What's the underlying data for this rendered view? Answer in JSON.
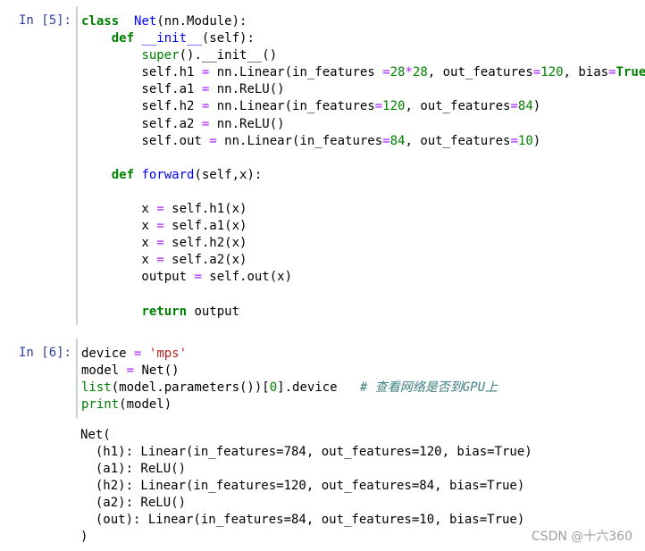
{
  "cells": [
    {
      "prompt": "In  [5]:",
      "lines": [
        [
          [
            "kw",
            "class"
          ],
          [
            "",
            "  "
          ],
          [
            "cls",
            "Net"
          ],
          [
            "",
            "(nn.Module):"
          ]
        ],
        [
          [
            "",
            "    "
          ],
          [
            "kw",
            "def"
          ],
          [
            "",
            ""
          ],
          [
            "fn",
            " __init__"
          ],
          [
            "",
            "(self):"
          ]
        ],
        [
          [
            "",
            "        "
          ],
          [
            "bi",
            "super"
          ],
          [
            "",
            "().__init__()"
          ]
        ],
        [
          [
            "",
            "        self.h1 "
          ],
          [
            "op",
            "="
          ],
          [
            "",
            ""
          ],
          [
            "",
            ""
          ],
          [
            "",
            " nn.Linear(in_features "
          ],
          [
            "op",
            "="
          ],
          [
            "num",
            "28"
          ],
          [
            "op",
            "*"
          ],
          [
            "num",
            "28"
          ],
          [
            "",
            ", out_features"
          ],
          [
            "op",
            "="
          ],
          [
            "num",
            "120"
          ],
          [
            "",
            ", bias"
          ],
          [
            "op",
            "="
          ],
          [
            "kw",
            "True"
          ],
          [
            "",
            ")"
          ]
        ],
        [
          [
            "",
            "        self.a1 "
          ],
          [
            "op",
            "="
          ],
          [
            "",
            " nn.ReLU()"
          ]
        ],
        [
          [
            "",
            "        self.h2 "
          ],
          [
            "op",
            "="
          ],
          [
            "",
            " nn.Linear(in_features"
          ],
          [
            "op",
            "="
          ],
          [
            "num",
            "120"
          ],
          [
            "",
            ", out_features"
          ],
          [
            "op",
            "="
          ],
          [
            "num",
            "84"
          ],
          [
            "",
            ")"
          ]
        ],
        [
          [
            "",
            "        self.a2 "
          ],
          [
            "op",
            "="
          ],
          [
            "",
            " nn.ReLU()"
          ]
        ],
        [
          [
            "",
            "        self.out "
          ],
          [
            "op",
            "="
          ],
          [
            "",
            " nn.Linear(in_features"
          ],
          [
            "op",
            "="
          ],
          [
            "num",
            "84"
          ],
          [
            "",
            ", out_features"
          ],
          [
            "op",
            "="
          ],
          [
            "num",
            "10"
          ],
          [
            "",
            ")"
          ]
        ],
        [
          [
            "",
            ""
          ]
        ],
        [
          [
            "",
            "    "
          ],
          [
            "kw",
            "def"
          ],
          [
            "fn",
            " forward"
          ],
          [
            "",
            "(self,x):"
          ]
        ],
        [
          [
            "",
            ""
          ]
        ],
        [
          [
            "",
            "        x "
          ],
          [
            "op",
            "="
          ],
          [
            "",
            " self.h1(x)"
          ]
        ],
        [
          [
            "",
            "        x "
          ],
          [
            "op",
            "="
          ],
          [
            "",
            " self.a1(x)"
          ]
        ],
        [
          [
            "",
            "        x "
          ],
          [
            "op",
            "="
          ],
          [
            "",
            " self.h2(x)"
          ]
        ],
        [
          [
            "",
            "        x "
          ],
          [
            "op",
            "="
          ],
          [
            "",
            " self.a2(x)"
          ]
        ],
        [
          [
            "",
            "        output "
          ],
          [
            "op",
            "="
          ],
          [
            "",
            " self.out(x)"
          ]
        ],
        [
          [
            "",
            ""
          ]
        ],
        [
          [
            "",
            "        "
          ],
          [
            "kw",
            "return"
          ],
          [
            "",
            " output"
          ]
        ]
      ]
    },
    {
      "prompt": "In  [6]:",
      "lines": [
        [
          [
            "",
            "device "
          ],
          [
            "op",
            "="
          ],
          [
            "",
            " "
          ],
          [
            "str",
            "'mps'"
          ]
        ],
        [
          [
            "",
            "model "
          ],
          [
            "op",
            "="
          ],
          [
            "",
            " Net()"
          ]
        ],
        [
          [
            "bi",
            "list"
          ],
          [
            "",
            "(model.parameters())["
          ],
          [
            "num",
            "0"
          ],
          [
            "",
            "].device   "
          ],
          [
            "cm",
            "# 查看网络是否到GPU上"
          ]
        ],
        [
          [
            "bi",
            "print"
          ],
          [
            "",
            "(model)"
          ]
        ]
      ]
    }
  ],
  "output": "Net(\n  (h1): Linear(in_features=784, out_features=120, bias=True)\n  (a1): ReLU()\n  (h2): Linear(in_features=120, out_features=84, bias=True)\n  (a2): ReLU()\n  (out): Linear(in_features=84, out_features=10, bias=True)\n)",
  "watermark": "CSDN @十六360"
}
